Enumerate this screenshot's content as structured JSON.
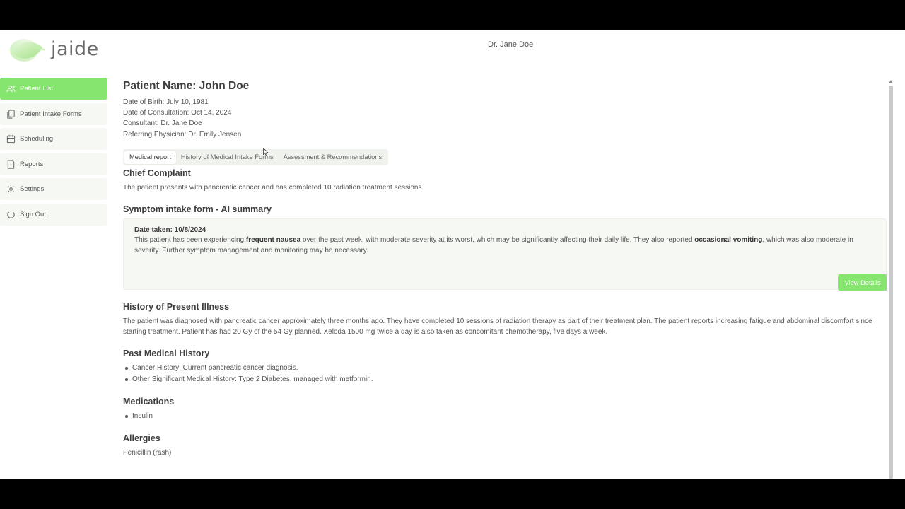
{
  "app": {
    "logo_text": "jaide",
    "brand_color": "#86e56e"
  },
  "header": {
    "doctor_name": "Dr. Jane Doe"
  },
  "sidebar": {
    "items": [
      {
        "label": "Patient List",
        "icon": "users-icon",
        "active": true
      },
      {
        "label": "Patient Intake Forms",
        "icon": "documents-icon",
        "active": false
      },
      {
        "label": "Scheduling",
        "icon": "calendar-icon",
        "active": false
      },
      {
        "label": "Reports",
        "icon": "report-plus-icon",
        "active": false
      },
      {
        "label": "Settings",
        "icon": "gear-icon",
        "active": false
      },
      {
        "label": "Sign Out",
        "icon": "power-icon",
        "active": false
      }
    ]
  },
  "patient": {
    "name_line": "Patient Name: John Doe",
    "dob": "Date of Birth: July 10, 1981",
    "consultation_date": "Date of Consultation: Oct 14, 2024",
    "consultant": "Consultant: Dr. Jane Doe",
    "referring": "Referring Physician: Dr. Emily Jensen"
  },
  "tabs": [
    {
      "label": "Medical report",
      "active": true
    },
    {
      "label": "History of Medical Intake Forms",
      "active": false
    },
    {
      "label": "Assessment & Recommendations",
      "active": false
    }
  ],
  "chief_complaint": {
    "title": "Chief Complaint",
    "text": "The patient presents with pancreatic cancer and has completed 10 radiation treatment sessions."
  },
  "ai_summary": {
    "title": "Symptom intake form - AI summary",
    "date_taken": "Date taken: 10/8/2024",
    "text_1": "This patient has been experiencing ",
    "bold_1": "frequent nausea",
    "text_2": " over the past week, with moderate severity at its worst, which may be significantly affecting their daily life. They also reported ",
    "bold_2": "occasional vomiting",
    "text_3": ", which was also moderate in severity. Further symptom management and monitoring may be necessary.",
    "button_label": "View Details"
  },
  "hpi": {
    "title": "History of Present Illness",
    "text": "The patient was diagnosed with pancreatic cancer approximately three months ago. They have completed 10 sessions of radiation therapy as part of their treatment plan. The patient reports increasing fatigue and abdominal discomfort since starting treatment. Patient has had 20 Gy of the 54 Gy planned. Xeloda 1500 mg twice a day is also taken as concomitant chemotherapy, five days a week."
  },
  "pmh": {
    "title": "Past Medical History",
    "items": [
      "Cancer History: Current pancreatic cancer diagnosis.",
      "Other Significant Medical History: Type 2 Diabetes, managed with metformin."
    ]
  },
  "medications": {
    "title": "Medications",
    "items": [
      "Insulin"
    ]
  },
  "allergies": {
    "title": "Allergies",
    "text": "Penicillin (rash)"
  }
}
